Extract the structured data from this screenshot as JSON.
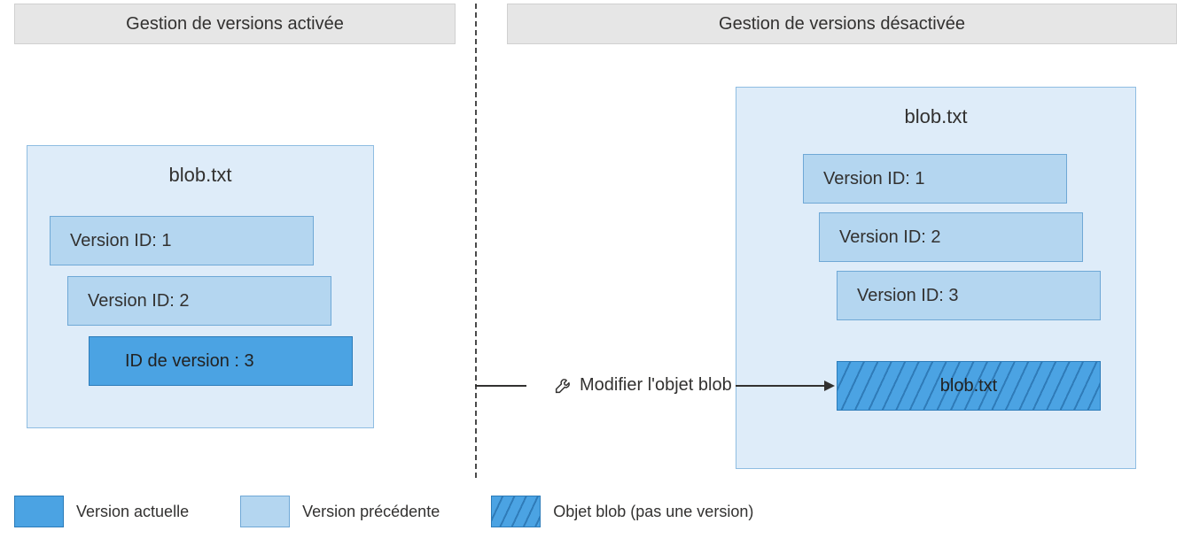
{
  "headers": {
    "left": "Gestion de versions activée",
    "right": "Gestion de versions désactivée"
  },
  "left": {
    "title": "blob.txt",
    "versions": {
      "v1": "Version ID: 1",
      "v2": "Version ID: 2",
      "v3": "ID de version : 3"
    }
  },
  "right": {
    "title": "blob.txt",
    "versions": {
      "v1": "Version ID: 1",
      "v2": "Version ID: 2",
      "v3": "Version ID: 3"
    },
    "blob_label": "blob.txt"
  },
  "action": {
    "label": "Modifier l'objet blob"
  },
  "legend": {
    "current": "Version actuelle",
    "previous": "Version précédente",
    "blob": "Objet blob (pas une version)"
  }
}
